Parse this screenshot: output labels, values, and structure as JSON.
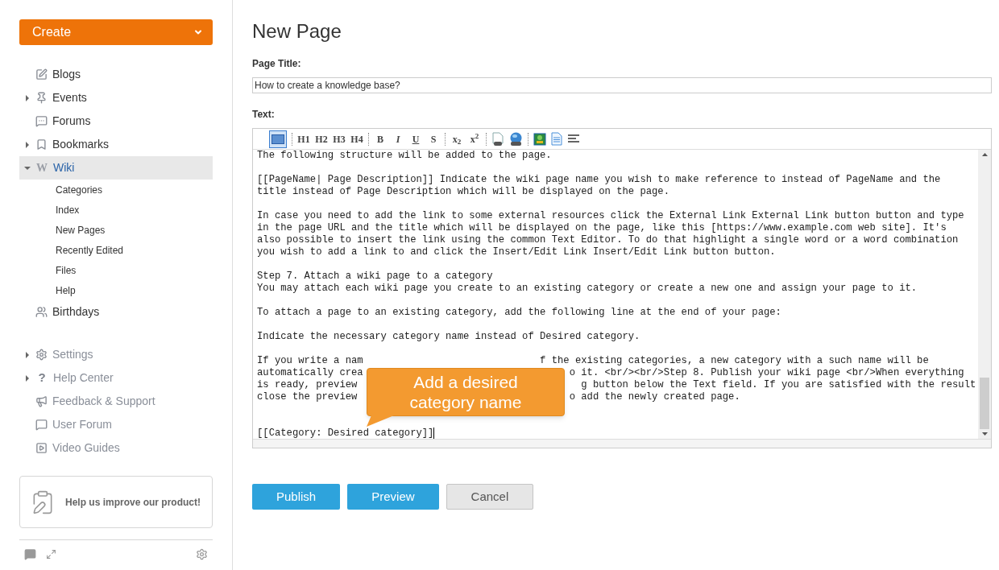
{
  "sidebar": {
    "create_button": "Create",
    "nav": [
      {
        "label": "Blogs",
        "selected": false
      },
      {
        "label": "Events",
        "expanded": false,
        "selected": false
      },
      {
        "label": "Forums",
        "selected": false
      },
      {
        "label": "Bookmarks",
        "expanded": false,
        "selected": false
      },
      {
        "label": "Wiki",
        "glyph": "W",
        "expanded": true,
        "selected": true,
        "children": [
          {
            "label": "Categories"
          },
          {
            "label": "Index"
          },
          {
            "label": "New Pages"
          },
          {
            "label": "Recently Edited"
          },
          {
            "label": "Files"
          },
          {
            "label": "Help"
          }
        ]
      },
      {
        "label": "Birthdays",
        "selected": false
      }
    ],
    "help_nav": [
      {
        "label": "Settings",
        "expanded": false
      },
      {
        "label": "Help Center",
        "glyph": "?",
        "expanded": false
      },
      {
        "label": "Feedback & Support"
      },
      {
        "label": "User Forum"
      },
      {
        "label": "Video Guides"
      }
    ],
    "feedback_card": "Help us improve our product!"
  },
  "main": {
    "title": "New Page",
    "page_title_label": "Page Title:",
    "page_title_value": "How to create a knowledge base?",
    "text_label": "Text:",
    "toolbar": [
      [
        {
          "kind": "wiki",
          "selected": true
        }
      ],
      [
        {
          "kind": "text",
          "label": "H1"
        },
        {
          "kind": "text",
          "label": "H2"
        },
        {
          "kind": "text",
          "label": "H3"
        },
        {
          "kind": "text",
          "label": "H4"
        }
      ],
      [
        {
          "kind": "text",
          "label": "B"
        },
        {
          "kind": "text",
          "label": "I"
        },
        {
          "kind": "text",
          "label": "U"
        },
        {
          "kind": "text",
          "label": "S"
        }
      ],
      [
        {
          "kind": "text",
          "label": "x$_{2}$"
        },
        {
          "kind": "text",
          "label": "x$^{2}$"
        }
      ],
      [
        {
          "kind": "attachment"
        },
        {
          "kind": "weblink"
        }
      ],
      [
        {
          "kind": "image"
        },
        {
          "kind": "document"
        },
        {
          "kind": "lines"
        }
      ]
    ],
    "editor_paragraphs": [
      [
        [
          "The following structure will be added to the page."
        ]
      ],
      [
        [
          "[[PageName| Page Description]] Indicate the wiki page name you wish to make reference to instead of PageName and the"
        ],
        [
          "title instead of Page Description which will be displayed on the page."
        ]
      ],
      [
        [
          "In case you need to add the link to some external resources click the External Link External Link button button and type"
        ],
        [
          "in the page URL and the title which will be displayed on the page, like this [https://www.example.com web site]. It's"
        ],
        [
          "also possible to insert the link using the common Text Editor. To do that highlight a single word or a word combination"
        ],
        [
          "you wish to add a link to and click the Insert/Edit Link Insert/Edit Link button button."
        ]
      ],
      [
        [
          "Step 7. Attach a wiki page to a category"
        ],
        [
          "You may attach each wiki page you create to an existing category or create a new one and assign your page to it."
        ]
      ],
      [
        [
          "To attach a page to an existing category, add the following line at the end of your page:"
        ]
      ],
      [
        [
          "Indicate the necessary category name instead of Desired category."
        ]
      ],
      [
        [
          "If you write a nam",
          "f the existing categories, a new category with a such name will be"
        ],
        [
          "automatically crea",
          "o it. <br/><br/>Step 8. Publish your wiki page <br/>When everything"
        ],
        [
          "is ready, preview",
          "g button below the Text field. If you are satisfied with the result"
        ],
        [
          "close the preview",
          "o add the newly created page."
        ]
      ],
      [
        [
          "[[Category: Desired category]]"
        ]
      ]
    ],
    "callout": "Add a desired category name",
    "buttons": [
      {
        "label": "Publish",
        "kind": "primary"
      },
      {
        "label": "Preview",
        "kind": "primary"
      },
      {
        "label": "Cancel",
        "kind": "secondary"
      }
    ]
  }
}
